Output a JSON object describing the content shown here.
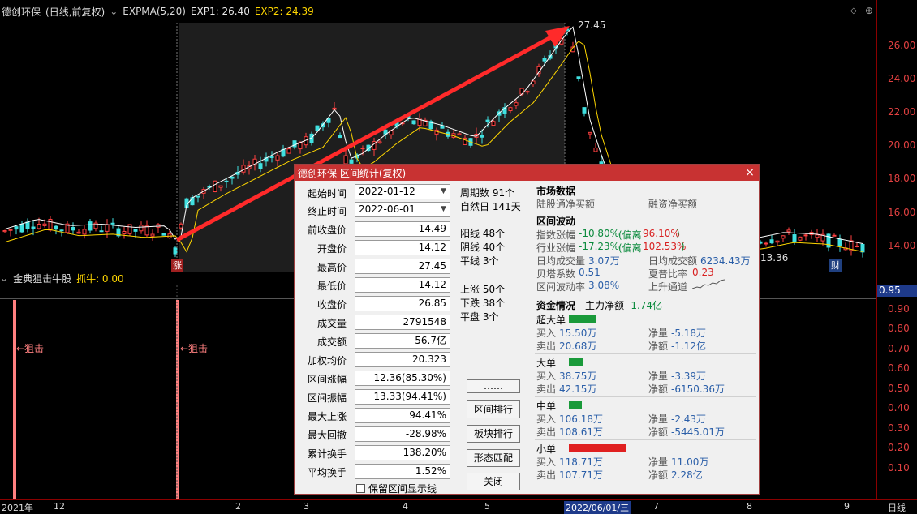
{
  "header": {
    "stock_name": "德创环保",
    "mode": "(日线,前复权)",
    "indicator": "EXPMA(5,20)",
    "exp1": "EXP1: 26.40",
    "exp2": "EXP2: 24.39"
  },
  "main_chart": {
    "peak_label": "27.45",
    "low_label": "13.36",
    "zhang_badge": "涨",
    "cai_badge": "财",
    "y_ticks": [
      "26.00",
      "24.00",
      "22.00",
      "20.00",
      "18.00",
      "16.00",
      "14.00"
    ]
  },
  "sub_chart": {
    "name": "金典狙击牛股",
    "param": "抓牛: 0.00",
    "current": "0.95",
    "y_ticks": [
      "0.90",
      "0.80",
      "0.70",
      "0.60",
      "0.50",
      "0.40",
      "0.30",
      "0.20",
      "0.10"
    ],
    "signal_label": "←狙击"
  },
  "x_axis": {
    "labels": [
      "2021年",
      "12",
      "2",
      "3",
      "4",
      "5",
      "2022/06/01/三",
      "7",
      "8",
      "9"
    ],
    "right_label": "日线"
  },
  "dialog": {
    "title": "德创环保 区间统计(复权)",
    "close_icon": "×",
    "fields": {
      "start_label": "起始时间",
      "start": "2022-01-12",
      "end_label": "终止时间",
      "end": "2022-06-01",
      "prev_close_label": "前收盘价",
      "prev_close": "14.49",
      "open_label": "开盘价",
      "open": "14.12",
      "high_label": "最高价",
      "high": "27.45",
      "low_label": "最低价",
      "low": "14.12",
      "close_label": "收盘价",
      "close": "26.85",
      "volume_label": "成交量",
      "volume": "2791548",
      "amount_label": "成交额",
      "amount": "56.7亿",
      "wavg_label": "加权均价",
      "wavg": "20.323",
      "range_chg_label": "区间涨幅",
      "range_chg": "12.36(85.30%)",
      "range_amp_label": "区间振幅",
      "range_amp": "13.33(94.41%)",
      "max_up_label": "最大上涨",
      "max_up": "94.41%",
      "max_dd_label": "最大回撤",
      "max_dd": "-28.98%",
      "turnover_label": "累计换手",
      "turnover": "138.20%",
      "avg_turn_label": "平均换手",
      "avg_turn": "1.52%"
    },
    "mid": {
      "periods": "周期数 91个",
      "natural_days": "自然日 141天",
      "yang": "阳线 48个",
      "yin": "阴线 40个",
      "flat": "平线 3个",
      "up": "上涨 50个",
      "down": "下跌 38个",
      "same": "平盘 3个"
    },
    "buttons": {
      "more": "……",
      "range_rank": "区间排行",
      "sector_rank": "板块排行",
      "pattern": "形态匹配",
      "close": "关闭"
    },
    "keep_display": "保留区间显示线",
    "market": {
      "title": "市场数据",
      "hk_label": "陆股通净买额",
      "hk_value": "--",
      "margin_label": "融资净买额",
      "margin_value": "--"
    },
    "volatility": {
      "title": "区间波动",
      "index_label": "指数涨幅",
      "index_value": "-10.80%",
      "index_dev_label": "(偏离",
      "index_dev": "96.10%",
      "industry_label": "行业涨幅",
      "industry_value": "-17.23%",
      "industry_dev_label": "(偏离",
      "industry_dev": "102.53%",
      "daily_vol_label": "日均成交量",
      "daily_vol": "3.07万",
      "daily_amt_label": "日均成交额",
      "daily_amt": "6234.43万",
      "beta_label": "贝塔系数",
      "beta": "0.51",
      "sharpe_label": "夏普比率",
      "sharpe": "0.23",
      "volrate_label": "区间波动率",
      "volrate": "3.08%",
      "channel_label": "上升通道"
    },
    "funds": {
      "title": "资金情况",
      "main_label": "主力净额",
      "main_value": "-1.74亿",
      "super": {
        "name": "超大单",
        "buy_label": "买入",
        "buy": "15.50万",
        "sell_label": "卖出",
        "sell": "20.68万",
        "net_vol_label": "净量",
        "net_vol": "-5.18万",
        "net_amt_label": "净额",
        "net_amt": "-1.12亿"
      },
      "large": {
        "name": "大单",
        "buy_label": "买入",
        "buy": "38.75万",
        "sell_label": "卖出",
        "sell": "42.15万",
        "net_vol_label": "净量",
        "net_vol": "-3.39万",
        "net_amt_label": "净额",
        "net_amt": "-6150.36万"
      },
      "medium": {
        "name": "中单",
        "buy_label": "买入",
        "buy": "106.18万",
        "sell_label": "卖出",
        "sell": "108.61万",
        "net_vol_label": "净量",
        "net_vol": "-2.43万",
        "net_amt_label": "净额",
        "net_amt": "-5445.01万"
      },
      "small": {
        "name": "小单",
        "buy_label": "买入",
        "buy": "118.71万",
        "sell_label": "卖出",
        "sell": "107.71万",
        "net_vol_label": "净量",
        "net_vol": "11.00万",
        "net_amt_label": "净额",
        "net_amt": "2.28亿"
      }
    }
  },
  "colors": {
    "up": "#ff4040",
    "down": "#40e0e0",
    "ma1": "#ffffff",
    "ma2": "#ffd700",
    "accent": "#c83232"
  }
}
